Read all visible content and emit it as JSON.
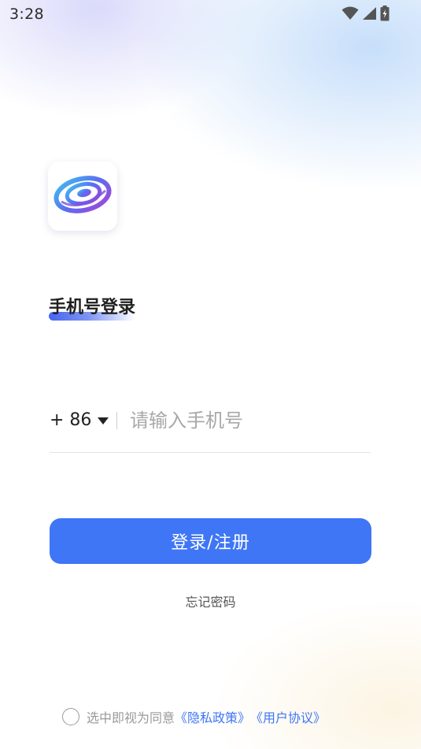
{
  "status_bar": {
    "time": "3:28",
    "icons": [
      "wifi-icon",
      "signal-icon",
      "battery-charging-icon"
    ]
  },
  "logo": {
    "icon": "galaxy-swirl-logo"
  },
  "title": "手机号登录",
  "phone": {
    "country_code": "+ 86",
    "placeholder": "请输入手机号",
    "value": ""
  },
  "login_button": "登录/注册",
  "forgot_password": "忘记密码",
  "agreement": {
    "prefix": "选中即视为同意",
    "privacy_link": "《隐私政策》",
    "terms_link": "《用户协议》"
  },
  "colors": {
    "accent": "#3f76f5",
    "text_primary": "#1f1f1f",
    "text_secondary": "#9a9a9a"
  }
}
